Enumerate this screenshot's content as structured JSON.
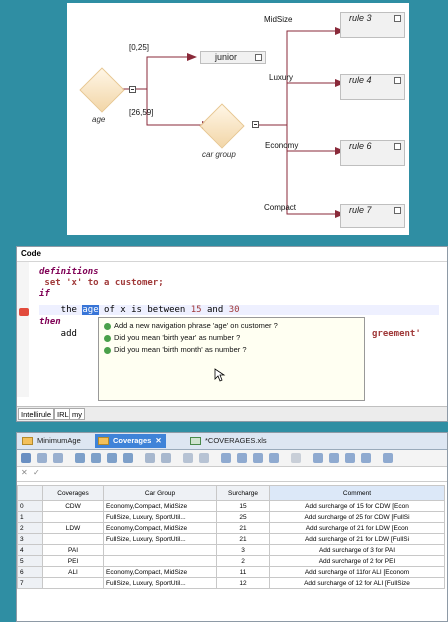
{
  "tree": {
    "root_label": "age",
    "child_label": "car group",
    "age_branches": [
      "[0,25]",
      "[26,59]"
    ],
    "junior_leaf": "junior",
    "car_branches": [
      "MidSize",
      "Luxury",
      "Economy",
      "Compact"
    ],
    "rule_leaves": [
      "rule 3",
      "rule 4",
      "rule 6",
      "rule 7"
    ]
  },
  "code": {
    "title": "Code",
    "line1": "definitions",
    "line2_a": " set 'x' to a customer;",
    "line3": "if",
    "line4_a": "    the ",
    "line4_sel": "age",
    "line4_b": " of x is between ",
    "line4_n1": "15",
    "line4_c": " and ",
    "line4_n2": "30",
    "line5": "then",
    "line6": "    add",
    "line6_tail": "greement'",
    "suggestions": [
      "Add a new navigation phrase 'age' on customer ?",
      "Did you mean 'birth year' as number ?",
      "Did you mean 'birth month' as number ?"
    ],
    "tabs": [
      "Intellirule",
      "IRL",
      "my"
    ]
  },
  "sheet": {
    "tabs": [
      "MinimumAge",
      "Coverages",
      "*COVERAGES.xls"
    ],
    "headers": [
      "Coverages",
      "Car Group",
      "Surcharge",
      "Comment"
    ],
    "rows": [
      {
        "n": "0",
        "cov": "CDW",
        "group": "Economy,Compact, MidSize",
        "sur": "15",
        "comment": "Add surcharge of 15 for CDW [Econ"
      },
      {
        "n": "1",
        "cov": "",
        "group": "FullSize, Luxury, SportUtil...",
        "sur": "25",
        "comment": "Add surcharge of 25 for CDW [FullSi"
      },
      {
        "n": "2",
        "cov": "LDW",
        "group": "Economy,Compact, MidSize",
        "sur": "21",
        "comment": "Add surcharge of 21 for LDW [Econ"
      },
      {
        "n": "3",
        "cov": "",
        "group": "FullSize, Luxury, SportUtil...",
        "sur": "21",
        "comment": "Add surcharge of 21 for LDW [FullSi"
      },
      {
        "n": "4",
        "cov": "PAI",
        "group": "",
        "sur": "3",
        "comment": "Add surcharge of 3 for PAI"
      },
      {
        "n": "5",
        "cov": "PEI",
        "group": "",
        "sur": "2",
        "comment": "Add surcharge of 2 for PEI"
      },
      {
        "n": "6",
        "cov": "ALI",
        "group": "Economy,Compact, MidSize",
        "sur": "11",
        "comment": "Add surcharge of 11for ALI [Econom"
      },
      {
        "n": "7",
        "cov": "",
        "group": "FullSize, Luxury, SportUtil...",
        "sur": "12",
        "comment": "Add surcharge of 12 for ALI [FullSize"
      }
    ]
  }
}
